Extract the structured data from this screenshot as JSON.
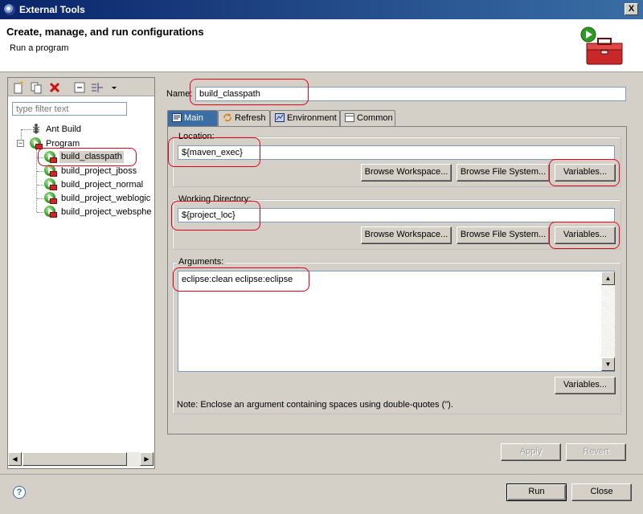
{
  "window": {
    "title": "External Tools",
    "close_glyph": "X"
  },
  "banner": {
    "title": "Create, manage, and run configurations",
    "subtitle": "Run a program",
    "icon": "toolbox-run-icon"
  },
  "left": {
    "toolbar": [
      "new-config-icon",
      "duplicate-icon",
      "delete-icon",
      "collapse-all-icon",
      "filter-icon",
      "dropdown-arrow-icon"
    ],
    "filter_placeholder": "type filter text",
    "tree": {
      "ant_build": "Ant Build",
      "program": "Program",
      "items": [
        "build_classpath",
        "build_project_jboss",
        "build_project_normal",
        "build_project_weblogic",
        "build_project_websphe"
      ],
      "selected": "build_classpath"
    }
  },
  "main": {
    "name_label": "Name:",
    "name_value": "build_classpath",
    "tabs": [
      {
        "label": "Main",
        "icon": "main-tab-icon",
        "active": true
      },
      {
        "label": "Refresh",
        "icon": "refresh-icon"
      },
      {
        "label": "Environment",
        "icon": "environment-icon"
      },
      {
        "label": "Common",
        "icon": "common-icon"
      }
    ],
    "location": {
      "label": "Location:",
      "value": "${maven_exec}",
      "browse_workspace": "Browse Workspace...",
      "browse_fs": "Browse File System...",
      "variables": "Variables..."
    },
    "working_dir": {
      "label": "Working Directory:",
      "value": "${project_loc}",
      "browse_workspace": "Browse Workspace...",
      "browse_fs": "Browse File System...",
      "variables": "Variables..."
    },
    "arguments": {
      "label": "Arguments:",
      "value": "eclipse:clean eclipse:eclipse",
      "variables": "Variables...",
      "note": "Note: Enclose an argument containing spaces using double-quotes (\")."
    },
    "apply": "Apply",
    "revert": "Revert"
  },
  "footer": {
    "help_glyph": "?",
    "run": "Run",
    "close": "Close"
  },
  "colors": {
    "titlebar": "#0a246a",
    "annotation": "#e0001a",
    "window": "#d4d0c8"
  }
}
